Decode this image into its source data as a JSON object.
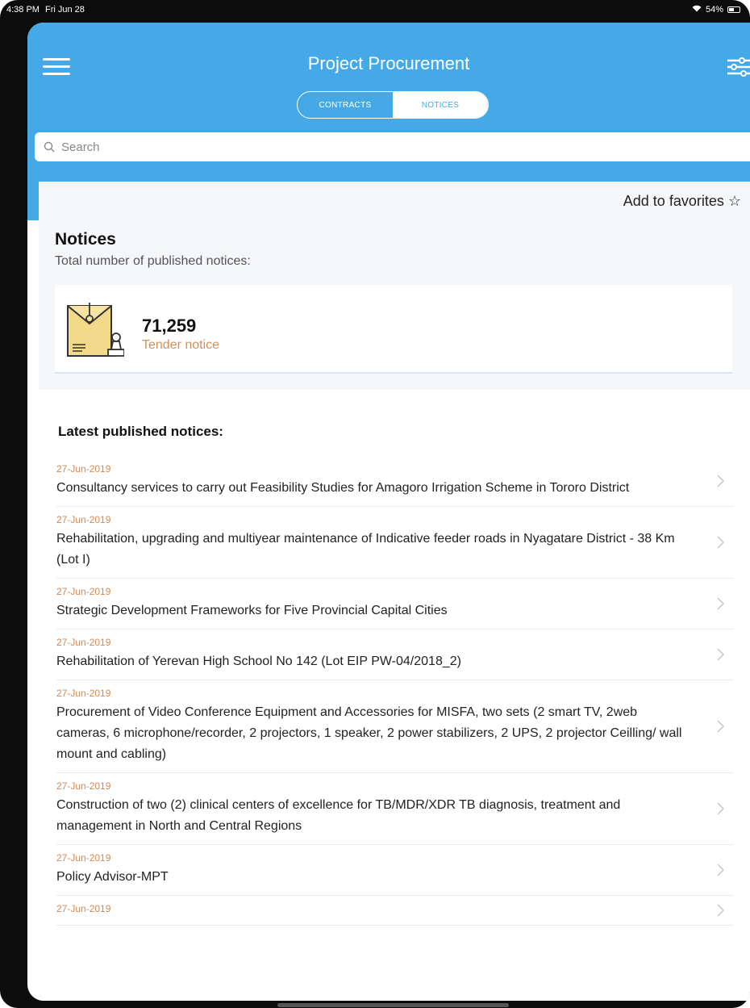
{
  "status_bar": {
    "time": "4:38 PM",
    "date": "Fri Jun 28",
    "battery": "54%",
    "battery_fill": 0.54
  },
  "header": {
    "title": "Project Procurement",
    "tabs": [
      {
        "label": "CONTRACTS",
        "active": false
      },
      {
        "label": "NOTICES",
        "active": true
      }
    ],
    "icons": {
      "menu": "hamburger-icon",
      "filter": "filter-icon"
    }
  },
  "search": {
    "placeholder": "Search",
    "value": "",
    "icon": "search-icon"
  },
  "summary": {
    "favorites_label": "Add to favorites ☆",
    "title": "Notices",
    "subtitle": "Total number of published notices:",
    "stat": {
      "count": "71,259",
      "label": "Tender notice",
      "icon": "envelope-stamp-icon"
    }
  },
  "latest": {
    "title": "Latest published notices:",
    "items": [
      {
        "date": "27-Jun-2019",
        "title": "Consultancy services to carry out Feasibility Studies for Amagoro Irrigation Scheme in Tororo District"
      },
      {
        "date": "27-Jun-2019",
        "title": "Rehabilitation, upgrading and multiyear maintenance of Indicative feeder roads in Nyagatare District - 38 Km (Lot I)"
      },
      {
        "date": "27-Jun-2019",
        "title": "Strategic Development Frameworks for Five Provincial Capital Cities"
      },
      {
        "date": "27-Jun-2019",
        "title": "Rehabilitation of Yerevan High School No 142 (Lot EIP PW-04/2018_2)"
      },
      {
        "date": "27-Jun-2019",
        "title": "Procurement of Video Conference Equipment and Accessories for MISFA, two sets (2 smart TV, 2web cameras, 6 microphone/recorder, 2 projectors, 1 speaker, 2 power stabilizers, 2 UPS, 2 projector Ceilling/ wall mount and cabling)"
      },
      {
        "date": "27-Jun-2019",
        "title": "Construction of two (2) clinical centers of excellence for TB/MDR/XDR TB diagnosis, treatment and management in North and Central Regions"
      },
      {
        "date": "27-Jun-2019",
        "title": "Policy Advisor-MPT"
      },
      {
        "date": "27-Jun-2019",
        "title": ""
      }
    ]
  },
  "colors": {
    "header": "#45a9e8",
    "date": "#d28a54",
    "tender_label": "#d0905a",
    "summary_bg": "#f4f6f9"
  }
}
